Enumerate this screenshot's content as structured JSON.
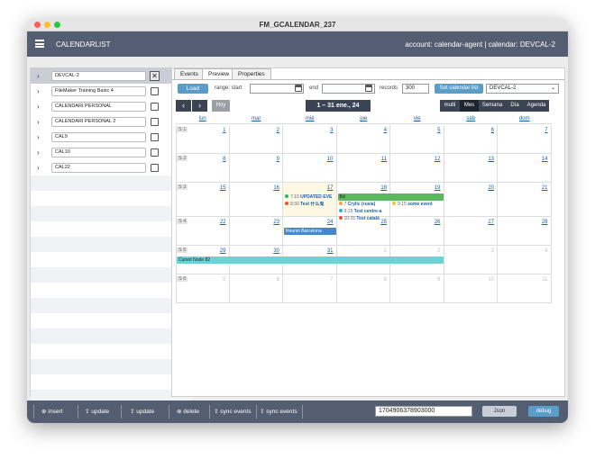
{
  "window": {
    "title": "FM_GCALENDAR_237"
  },
  "appbar": {
    "title": "CALENDARLIST",
    "account": "account: calendar-agent | calendar: DEVCAL-2"
  },
  "calendar_list": [
    {
      "name": "DEVCAL-2",
      "color": "#f5c242",
      "selected": true
    },
    {
      "name": "FileMaker Training Basic 4",
      "color": "#e8553e",
      "selected": false
    },
    {
      "name": "CALENDARI PERSONAL",
      "color": "#e8553e",
      "selected": false
    },
    {
      "name": "CALENDARI PERSONAL 2",
      "color": "#e8553e",
      "selected": false
    },
    {
      "name": "CAL9",
      "color": "#b0b0b0",
      "selected": false
    },
    {
      "name": "CAL10",
      "color": "#3a7bd5",
      "selected": false
    },
    {
      "name": "CAL22",
      "color": "#f5a623",
      "selected": false
    }
  ],
  "remove_label": "✕",
  "tabs": [
    "Events",
    "Preview",
    "Properties"
  ],
  "active_tab": "Preview",
  "toolbar": {
    "load_label": "Load",
    "range_start_label": "range: start",
    "end_label": "end",
    "records_label": "records",
    "records_value": "300",
    "set_list_label": "Set calendar list",
    "calendar_select": "DEVCAL-2"
  },
  "calendar_nav": {
    "prev": "‹",
    "next": "›",
    "today": "Hoy",
    "title": "1 – 31 ene., 24",
    "views": [
      "multi",
      "Mes",
      "Semana",
      "Día",
      "Agenda"
    ],
    "active_view": "Mes"
  },
  "day_headers": [
    "lun",
    "mar",
    "mié",
    "jue",
    "vie",
    "sáb",
    "dom"
  ],
  "weeks": [
    {
      "label": "S 1",
      "days": [
        "1",
        "2",
        "3",
        "4",
        "5",
        "6",
        "7"
      ],
      "other": [
        false,
        false,
        false,
        false,
        false,
        false,
        false
      ]
    },
    {
      "label": "S 2",
      "days": [
        "8",
        "9",
        "10",
        "11",
        "12",
        "13",
        "14"
      ],
      "other": [
        false,
        false,
        false,
        false,
        false,
        false,
        false
      ]
    },
    {
      "label": "S 3",
      "days": [
        "15",
        "16",
        "17",
        "18",
        "19",
        "20",
        "21"
      ],
      "other": [
        false,
        false,
        false,
        false,
        false,
        false,
        false
      ]
    },
    {
      "label": "S 4",
      "days": [
        "22",
        "23",
        "24",
        "25",
        "26",
        "27",
        "28"
      ],
      "other": [
        false,
        false,
        false,
        false,
        false,
        false,
        false
      ]
    },
    {
      "label": "S 5",
      "days": [
        "29",
        "30",
        "31",
        "1",
        "2",
        "3",
        "4"
      ],
      "other": [
        false,
        false,
        false,
        true,
        true,
        true,
        true
      ]
    },
    {
      "label": "S 6",
      "days": [
        "5",
        "6",
        "7",
        "8",
        "9",
        "10",
        "11"
      ],
      "other": [
        true,
        true,
        true,
        true,
        true,
        true,
        true
      ]
    }
  ],
  "today_index": {
    "week": 2,
    "day": 2
  },
  "events": {
    "dot_events": [
      {
        "time": "7:15",
        "title": "UPDATED EVE",
        "color": "#2bb673",
        "week": 2,
        "day": 2,
        "slot": 0
      },
      {
        "time": "9:30",
        "title": "Test 什么鬼",
        "color": "#e8553e",
        "week": 2,
        "day": 2,
        "slot": 1
      },
      {
        "time": "7",
        "title": "Crylic (rusia)",
        "color": "#f5a623",
        "week": 2,
        "day": 3,
        "slot": 1
      },
      {
        "time": "9:15",
        "title": "Test centre-a",
        "color": "#2bb6c8",
        "week": 2,
        "day": 3,
        "slot": 2
      },
      {
        "time": "10:15",
        "title": "Test català",
        "color": "#e8553e",
        "week": 2,
        "day": 3,
        "slot": 3
      },
      {
        "time": "9:15",
        "title": "some event",
        "color": "#f5c242",
        "week": 2,
        "day": 4,
        "slot": 1
      }
    ],
    "bar_events": [
      {
        "title": "Bd",
        "color": "#5cb85c",
        "week": 2,
        "day_start": 3,
        "day_end": 4,
        "slot": 0
      },
      {
        "title": "Reunio Barcelona",
        "color": "#4a86c8",
        "text_color": "#ffffff",
        "week": 3,
        "day_start": 2,
        "day_end": 2,
        "slot": 0
      },
      {
        "title": "Cursot Node 82",
        "color": "#6fd0d8",
        "week": 4,
        "day_start": 0,
        "day_end": 4,
        "slot": 0
      }
    ]
  },
  "bottombar": {
    "insert": "Insert",
    "update1": "update",
    "update2": "update",
    "delete": "delete",
    "sync1": "sync events",
    "sync2": "sync events",
    "id_value": "1704906378903000",
    "json": "Json",
    "debug": "debug"
  }
}
